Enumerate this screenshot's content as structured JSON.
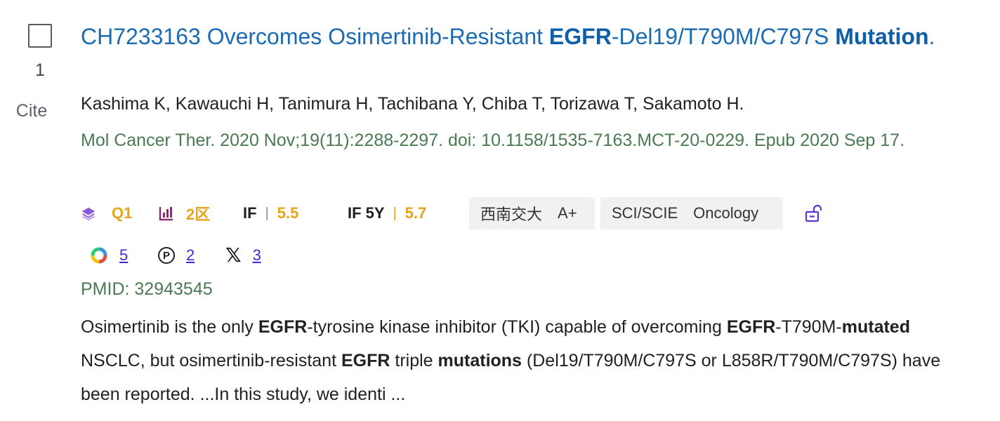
{
  "result": {
    "index": "1",
    "cite_label": "Cite",
    "title_parts": {
      "p1": "CH7233163 Overcomes Osimertinib-Resistant ",
      "p2": "EGFR",
      "p3": "-Del19/T790M/C797S ",
      "p4": "Mutation",
      "p5": "."
    },
    "authors": "Kashima K, Kawauchi H, Tanimura H, Tachibana Y, Chiba T, Torizawa T, Sakamoto H.",
    "citation": "Mol Cancer Ther. 2020 Nov;19(11):2288-2297. doi: 10.1158/1535-7163.MCT-20-0229. Epub 2020 Sep 17.",
    "badges": {
      "quartile": "Q1",
      "zone": "2区",
      "if_label": "IF",
      "if_sep": "|",
      "if_value": "5.5",
      "if5y_label": "IF 5Y",
      "if5y_sep": "|",
      "if5y_value": "5.7",
      "univ_name": "西南交大",
      "univ_grade": "A+",
      "index_db": "SCI/SCIE",
      "field": "Oncology"
    },
    "metrics": {
      "altmetric": "5",
      "plumx_glyph": "P",
      "plumx": "2",
      "x_glyph": "𝕏",
      "x": "3"
    },
    "pmid": "PMID: 32943545",
    "abstract_parts": {
      "a1": "Osimertinib is the only ",
      "a2": "EGFR",
      "a3": "-tyrosine kinase inhibitor (TKI) capable of overcoming ",
      "a4": "EGFR",
      "a5": "-T790M-",
      "a6": "mutated",
      "a7": " NSCLC, but osimertinib-resistant ",
      "a8": "EGFR",
      "a9": " triple ",
      "a10": "mutations",
      "a11": " (Del19/T790M/C797S or L858R/T790M/C797S) have been reported. ...In this study, we identi ..."
    }
  },
  "colors": {
    "title": "#1a6bb3",
    "citation": "#4a7a52",
    "metric_value": "#e8a317",
    "link": "#3b2bd0",
    "tag_bg": "#f1f1f1"
  },
  "icons": {
    "quartile": "layers-icon",
    "zone": "bar-chart-icon",
    "lock": "unlock-icon",
    "altmetric": "altmetric-donut-icon",
    "plumx": "plumx-icon",
    "x": "x-logo-icon"
  }
}
